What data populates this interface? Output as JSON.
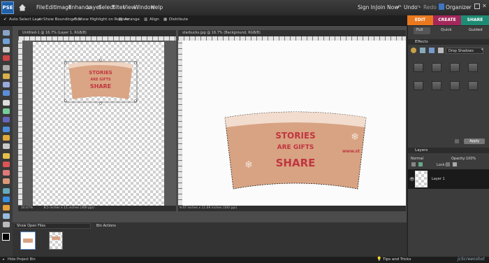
{
  "menubar": {
    "logo_text": "PSE",
    "items": [
      "File",
      "Edit",
      "Image",
      "Enhance",
      "Layer",
      "Select",
      "Filter",
      "View",
      "Window",
      "Help"
    ],
    "right_items": [
      "Sign In",
      "Join Now",
      "Undo",
      "Redo",
      "Organizer"
    ]
  },
  "options_bar": {
    "auto_select": "Auto Select Layer",
    "bounding_box": "Show Bounding Box",
    "highlight": "Show Highlight on Rollover",
    "arrange": "Arrange",
    "align": "Align",
    "distribute": "Distribute"
  },
  "mode_tabs": {
    "edit": "EDIT",
    "create": "CREATE",
    "share": "SHARE"
  },
  "doc_left": {
    "title": "Untitled-1 @ 16.7% (Layer 1, RGB/8)",
    "zoom": "16.67%",
    "info": "8.5 inches x 11 inches (300 ppi)"
  },
  "doc_right": {
    "title": "starbucks.jpg @ 16.7% (Background, RGB/8)",
    "zoom": "16.67%",
    "info": "9.47 inches x 11.69 inches (300 ppi)"
  },
  "sleeve": {
    "line1": "STORIES",
    "line2": "ARE GIFTS",
    "line3": "SHARE",
    "side": "www.st"
  },
  "panel": {
    "subtabs": [
      "Full",
      "Quick",
      "Guided"
    ],
    "effects_header": "Effects",
    "effects_dropdown": "Drop Shadows",
    "apply": "Apply",
    "layers_header": "Layers",
    "blend_mode": "Normal",
    "opacity_label": "Opacity:",
    "opacity_value": "100%",
    "lock_label": "Lock:",
    "layer_name": "Layer 1"
  },
  "bin": {
    "show_dropdown": "Show Open Files",
    "actions": "Bin Actions"
  },
  "bottom": {
    "hide_bin": "Hide Project Bin",
    "tips": "Tips and Tricks",
    "watermark": "jcScreenshot"
  }
}
